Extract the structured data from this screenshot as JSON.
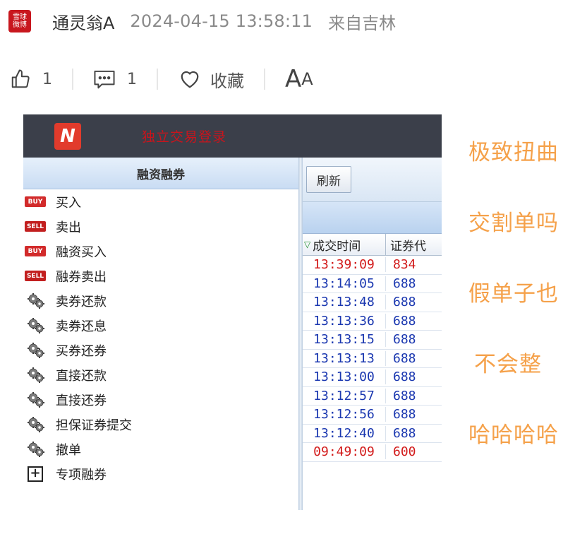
{
  "post": {
    "avatar_text": "雪球\n微博",
    "username": "通灵翁A",
    "timestamp": "2024-04-15 13:58:11",
    "location": "来自吉林"
  },
  "actions": {
    "like_count": "1",
    "comment_count": "1",
    "favorite_label": "收藏",
    "font_size_label_big": "A",
    "font_size_label_small": "A"
  },
  "app": {
    "logo_letter": "N",
    "title": "独立交易登录",
    "sidebar_header": "融资融券",
    "menu": [
      {
        "badge": "BUY",
        "label": "买入"
      },
      {
        "badge": "SELL",
        "label": "卖出"
      },
      {
        "badge": "BUY",
        "label": "融资买入"
      },
      {
        "badge": "SELL",
        "label": "融券卖出"
      },
      {
        "badge": "",
        "label": "卖券还款"
      },
      {
        "badge": "",
        "label": "卖券还息"
      },
      {
        "badge": "",
        "label": "买券还券"
      },
      {
        "badge": "",
        "label": "直接还款"
      },
      {
        "badge": "",
        "label": "直接还券"
      },
      {
        "badge": "",
        "label": "担保证券提交"
      },
      {
        "badge": "",
        "label": "撤单"
      },
      {
        "badge": "",
        "label": "专项融券"
      }
    ],
    "refresh_label": "刷新",
    "columns": [
      "成交时间",
      "证券代"
    ],
    "rows": [
      {
        "time": "13:39:09",
        "code": "834",
        "color": "red"
      },
      {
        "time": "13:14:05",
        "code": "688",
        "color": "blue"
      },
      {
        "time": "13:13:48",
        "code": "688",
        "color": "blue"
      },
      {
        "time": "13:13:36",
        "code": "688",
        "color": "blue"
      },
      {
        "time": "13:13:15",
        "code": "688",
        "color": "blue"
      },
      {
        "time": "13:13:13",
        "code": "688",
        "color": "blue"
      },
      {
        "time": "13:13:00",
        "code": "688",
        "color": "blue"
      },
      {
        "time": "13:12:57",
        "code": "688",
        "color": "blue"
      },
      {
        "time": "13:12:56",
        "code": "688",
        "color": "blue"
      },
      {
        "time": "13:12:40",
        "code": "688",
        "color": "blue"
      },
      {
        "time": "09:49:09",
        "code": "600",
        "color": "red"
      }
    ]
  },
  "notes": [
    "极致扭曲",
    "交割单吗",
    "假单子也",
    "不会整",
    "哈哈哈哈"
  ],
  "colors": {
    "note": "#f5a14a",
    "titlebar": "#3b3f4a",
    "row_blue": "#1a37b0",
    "row_red": "#d21a1a"
  }
}
